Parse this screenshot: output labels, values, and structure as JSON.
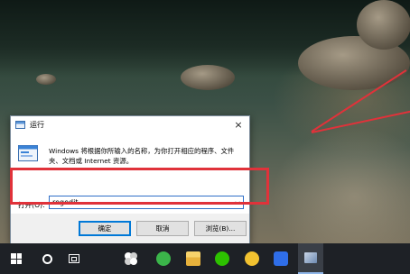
{
  "dialog": {
    "title": "运行",
    "description": "Windows 将根据你所输入的名称，为你打开相应的程序、文件夹、文档或 Internet 资源。",
    "open_label": "打开(O):",
    "input_value": "regedit",
    "buttons": {
      "ok": "确定",
      "cancel": "取消",
      "browse": "浏览(B)..."
    },
    "close_icon": "×"
  },
  "icons": {
    "dialog_app": "run-app-icon",
    "run_program": "run-program-icon",
    "close": "close-icon",
    "dropdown": "chevron-down-icon"
  },
  "annotation": {
    "highlight_color": "#e0323a"
  },
  "taskbar": {
    "items": [
      {
        "name": "start",
        "icon": "windows-logo-icon"
      },
      {
        "name": "search",
        "icon": "search-circle-icon"
      },
      {
        "name": "task-view",
        "icon": "task-view-icon"
      },
      {
        "name": "app-pinwheel",
        "icon": "pinwheel-app-icon"
      },
      {
        "name": "app-green-circle",
        "icon": "green-refresh-app-icon"
      },
      {
        "name": "file-explorer",
        "icon": "folder-icon"
      },
      {
        "name": "wechat",
        "icon": "wechat-icon"
      },
      {
        "name": "app-yellow",
        "icon": "yellow-app-icon"
      },
      {
        "name": "wps",
        "icon": "wps-icon"
      },
      {
        "name": "app-active",
        "icon": "active-window-icon"
      }
    ],
    "colors": {
      "background": "#1e2126",
      "accent": "#8fb6e8"
    }
  }
}
